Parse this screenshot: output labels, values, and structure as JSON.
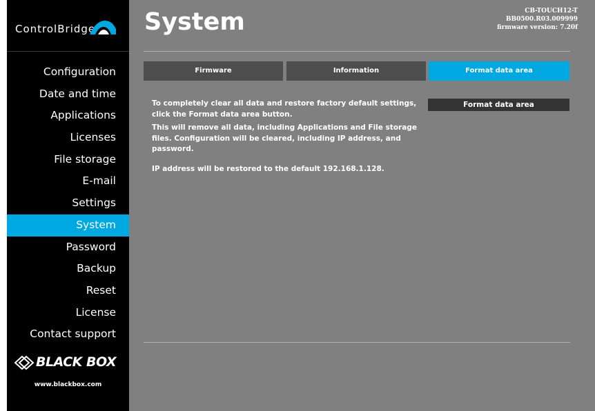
{
  "brand": {
    "logo_part1": "Control",
    "logo_part2": "Bridge",
    "footer_logo": "BLACK BOX",
    "footer_url": "www.blackbox.com"
  },
  "colors": {
    "accent": "#00a8e1",
    "sidebar_bg": "#000000",
    "main_bg": "#808080",
    "tab_bg": "#4d4d4d",
    "button_bg": "#333333"
  },
  "sidebar": {
    "items": [
      {
        "label": "Configuration"
      },
      {
        "label": "Date and time"
      },
      {
        "label": "Applications"
      },
      {
        "label": "Licenses"
      },
      {
        "label": "File storage"
      },
      {
        "label": "E-mail"
      },
      {
        "label": "Settings"
      },
      {
        "label": "System",
        "active": true
      },
      {
        "label": "Password"
      },
      {
        "label": "Backup"
      },
      {
        "label": "Reset"
      },
      {
        "label": "License"
      },
      {
        "label": "Contact support"
      }
    ]
  },
  "header": {
    "title": "System",
    "device_model": "CB-TOUCH12-T",
    "device_serial": "BB0500.R03.009999",
    "firmware": "firmware version: 7.20f"
  },
  "tabs": [
    {
      "label": "Firmware",
      "active": false
    },
    {
      "label": "Information",
      "active": false
    },
    {
      "label": "Format data area",
      "active": true
    }
  ],
  "content": {
    "paragraph1": "To completely clear all data and restore factory default settings, click the Format data area button.",
    "paragraph2": "This will remove all data, including Applications and File storage files. Configuration will be cleared, including IP address, and password.",
    "paragraph3": "IP address will be restored to the default 192.168.1.128.",
    "format_button_label": "Format data area"
  }
}
